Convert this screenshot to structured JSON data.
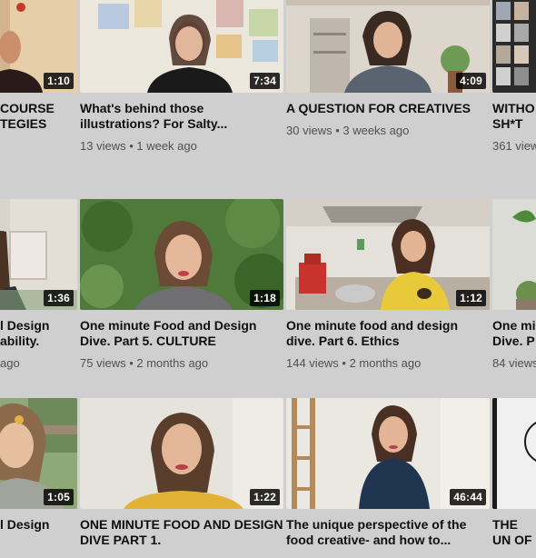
{
  "colors": {
    "page_background": "#cfcfcf",
    "duration_badge": "#000000",
    "title_text": "#0f0f0f",
    "meta_text": "#505050"
  },
  "rows": [
    {
      "videos": [
        {
          "duration": "1:10",
          "title": "COURSE TEGIES",
          "meta": ""
        },
        {
          "duration": "7:34",
          "title": "What's behind those illustrations? For Salty...",
          "meta": "13 views • 1 week ago"
        },
        {
          "duration": "4:09",
          "title": "A QUESTION FOR CREATIVES",
          "meta": "30 views • 3 weeks ago"
        },
        {
          "duration": "",
          "title": "WITHO SH*T",
          "meta": "361 view"
        }
      ]
    },
    {
      "videos": [
        {
          "duration": "1:36",
          "title": "l Design ability.",
          "meta": "ago"
        },
        {
          "duration": "1:18",
          "title": "One minute Food and Design Dive. Part 5. CULTURE",
          "meta": "75 views • 2 months ago"
        },
        {
          "duration": "1:12",
          "title": "One minute food and design dive. Part 6. Ethics",
          "meta": "144 views • 2 months ago"
        },
        {
          "duration": "",
          "title": "One mi Dive. P",
          "meta": "84 views"
        }
      ]
    },
    {
      "videos": [
        {
          "duration": "1:05",
          "title": "l Design",
          "meta": ""
        },
        {
          "duration": "1:22",
          "title": "ONE MINUTE FOOD AND DESIGN DIVE PART 1.",
          "meta": ""
        },
        {
          "duration": "46:44",
          "title": "The unique perspective of the food creative- and how to...",
          "meta": ""
        },
        {
          "duration": "",
          "title": "THE UN OF THE",
          "meta": ""
        }
      ]
    }
  ]
}
